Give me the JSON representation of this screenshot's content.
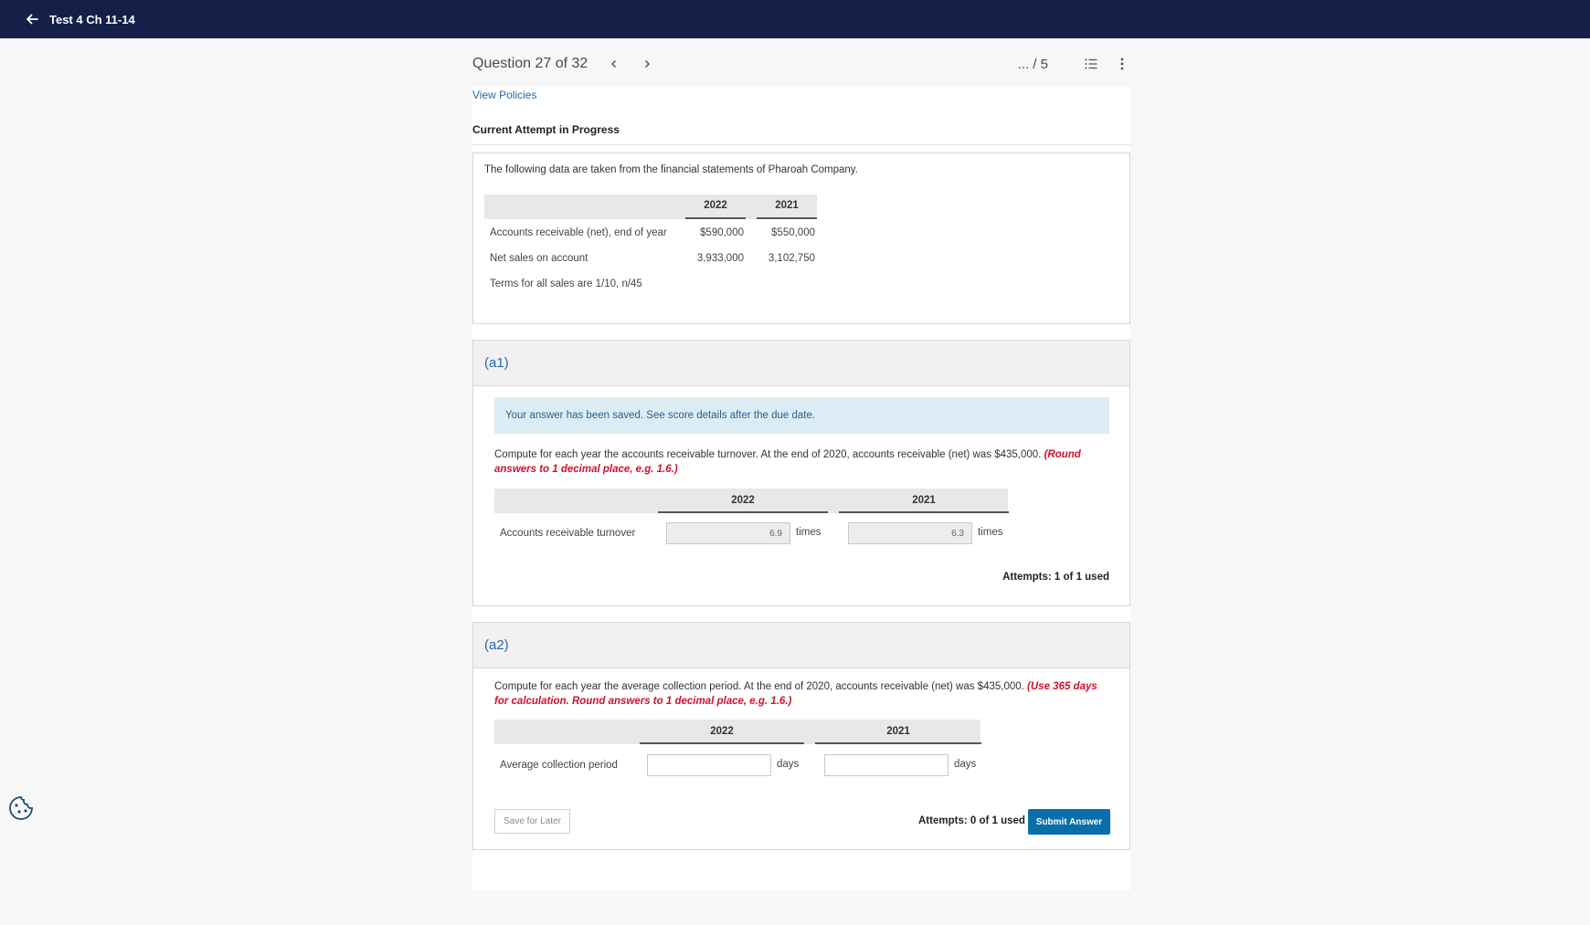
{
  "topbar": {
    "title": "Test 4 Ch 11-14"
  },
  "question_header": {
    "title": "Question 27 of 32",
    "score": "... / 5"
  },
  "links": {
    "view_policies": "View Policies"
  },
  "attempt_status": "Current Attempt in Progress",
  "data_card": {
    "intro": "The following data are taken from the financial statements of Pharoah Company.",
    "columns": [
      "2022",
      "2021"
    ],
    "rows": [
      {
        "label": "Accounts receivable (net), end of year",
        "values": [
          "$590,000",
          "$550,000"
        ]
      },
      {
        "label": "Net sales on account",
        "values": [
          "3,933,000",
          "3,102,750"
        ]
      }
    ],
    "terms": "Terms for all sales are 1/10, n/45"
  },
  "part_a1": {
    "label": "(a1)",
    "saved_message": "Your answer has been saved. See score details after the due date.",
    "instruction": "Compute for each year the accounts receivable turnover. At the end of 2020, accounts receivable (net) was $435,000.",
    "instruction_note": "(Round answers to 1 decimal place, e.g. 1.6.)",
    "columns": [
      "2022",
      "2021"
    ],
    "row_label": "Accounts receivable turnover",
    "values": [
      "6.9",
      "6.3"
    ],
    "unit": "times",
    "attempts": "Attempts: 1 of 1 used"
  },
  "part_a2": {
    "label": "(a2)",
    "instruction": "Compute for each year the average collection period. At the end of 2020, accounts receivable (net) was $435,000.",
    "instruction_note": "(Use 365 days for calculation. Round answers to 1 decimal place, e.g. 1.6.)",
    "columns": [
      "2022",
      "2021"
    ],
    "row_label": "Average collection period",
    "values": [
      "",
      ""
    ],
    "unit": "days",
    "attempts": "Attempts: 0 of 1 used",
    "save_later": "Save for Later",
    "submit": "Submit Answer"
  },
  "colors": {
    "topbar": "#152048",
    "link": "#2769a8",
    "note_red": "#d0112b",
    "submit": "#0a6fa8",
    "saved_bg": "#dcecf5"
  },
  "icons": [
    "arrow-left-icon",
    "chevron-left-icon",
    "chevron-right-icon",
    "list-icon",
    "more-vertical-icon",
    "cookie-icon"
  ]
}
